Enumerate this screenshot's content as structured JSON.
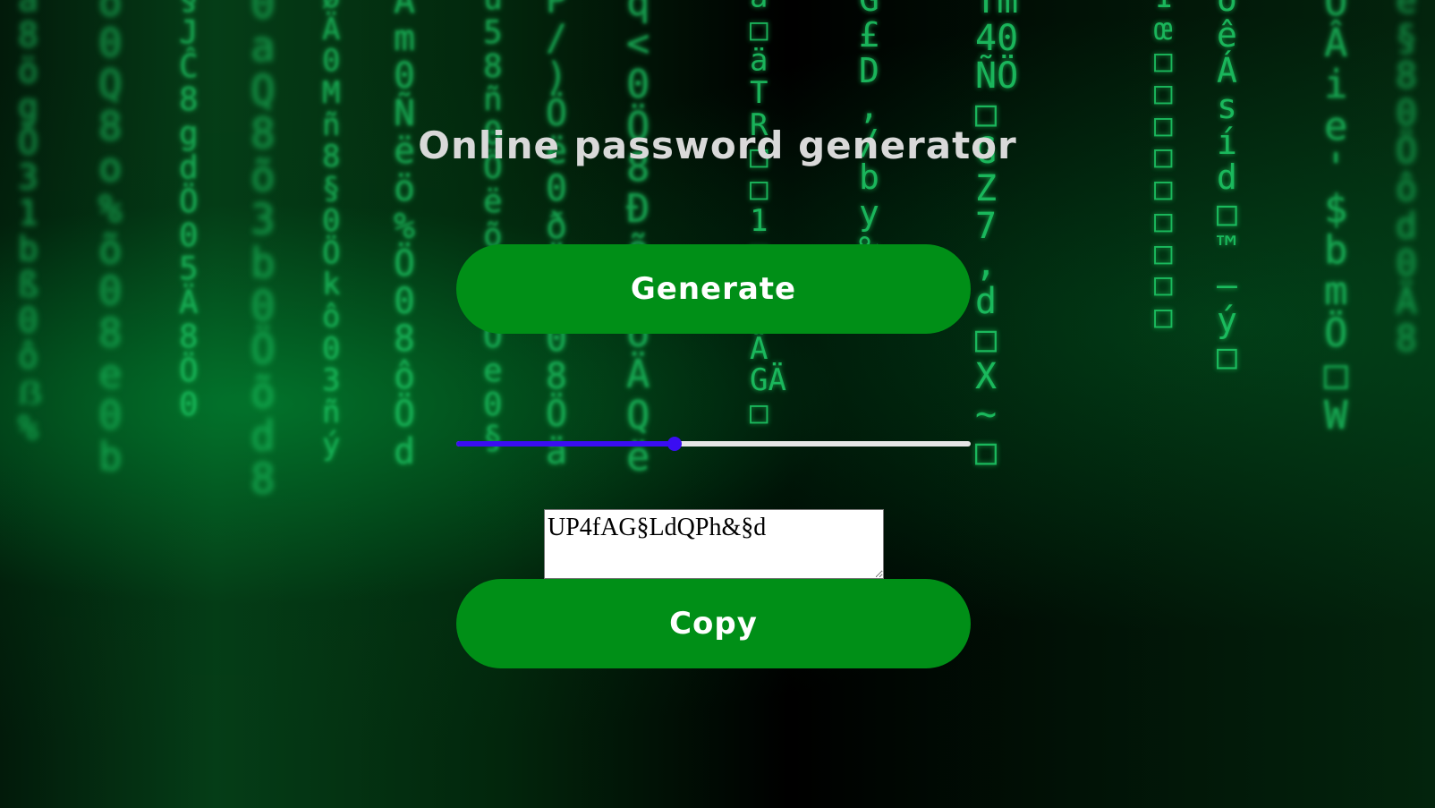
{
  "page": {
    "title": "Online password generator"
  },
  "buttons": {
    "generate_label": "Generate",
    "copy_label": "Copy"
  },
  "slider": {
    "value_fraction": 0.425
  },
  "output": {
    "password": "UP4fAG§LdQPh&§d"
  },
  "colors": {
    "button_bg": "#008f17",
    "button_text": "#ffffff",
    "title_text": "#d9d9d9",
    "slider_accent": "#3a0df2",
    "slider_track": "#e6e6e6",
    "matrix_green": "#1fd16a"
  },
  "background": {
    "image": "matrix-code-rain"
  }
}
